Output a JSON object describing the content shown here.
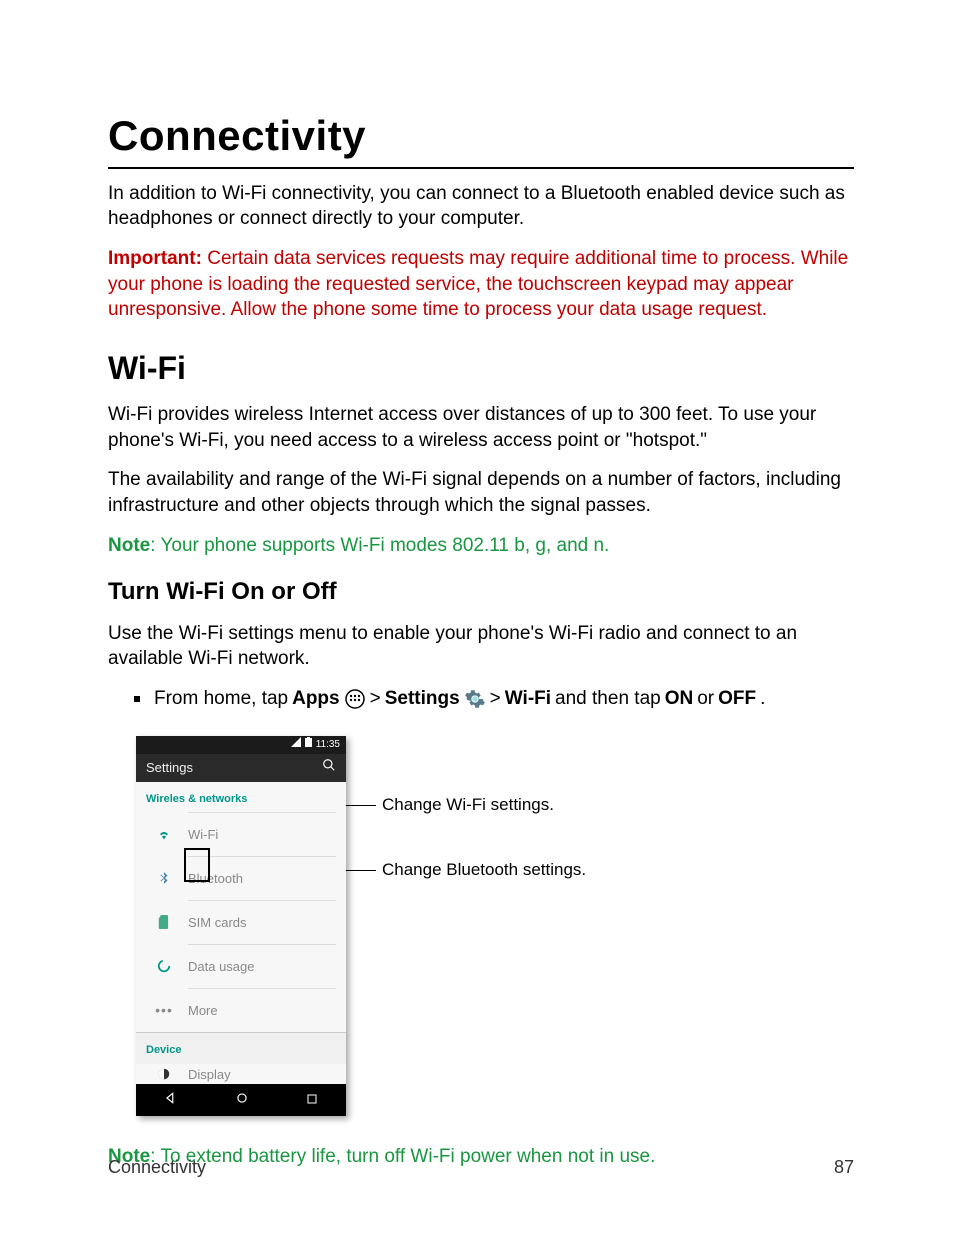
{
  "page": {
    "title": "Connectivity",
    "intro": "In addition to Wi-Fi connectivity, you can connect to a Bluetooth enabled device such as headphones or connect directly to your computer.",
    "important_label": "Important:",
    "important_text": " Certain data services requests may require additional time to process. While your phone is loading the requested service, the touchscreen keypad may appear unresponsive. Allow the phone some time to process your data usage request."
  },
  "wifi": {
    "heading": "Wi-Fi",
    "p1": "Wi-Fi provides wireless Internet access over distances of up to 300 feet. To use your phone's Wi-Fi, you need access to a wireless access point or \"hotspot.\"",
    "p2": "The availability and range of the Wi-Fi signal depends on a number of factors, including infrastructure and other objects through which the signal passes.",
    "note1_label": "Note",
    "note1_text": ": Your phone supports Wi-Fi modes 802.11 b, g, and n."
  },
  "turn": {
    "heading": "Turn Wi-Fi On or Off",
    "p1": "Use the Wi-Fi settings menu to enable your phone's Wi-Fi radio and connect to an available Wi-Fi network.",
    "step_prefix": "From home, tap ",
    "apps": "Apps",
    "gt1": " > ",
    "settings": "Settings",
    "gt2": " > ",
    "wifi": "Wi-Fi",
    "and": " and then tap ",
    "on": "ON",
    "or": " or ",
    "off": "OFF",
    "period": "."
  },
  "phone": {
    "time": "11:35",
    "appbar_title": "Settings",
    "section1": "Wireles & networks",
    "rows": {
      "wifi": "Wi-Fi",
      "bluetooth": "Bluetooth",
      "sim": "SIM cards",
      "data": "Data usage",
      "more": "More"
    },
    "section2": "Device",
    "display_row": "Display"
  },
  "callouts": {
    "wifi": "Change Wi-Fi settings.",
    "bluetooth": "Change Bluetooth settings."
  },
  "note2_label": "Note",
  "note2_text": ": To extend battery life, turn off  Wi-Fi power when not in use.",
  "footer": {
    "left": "Connectivity",
    "right": "87"
  }
}
